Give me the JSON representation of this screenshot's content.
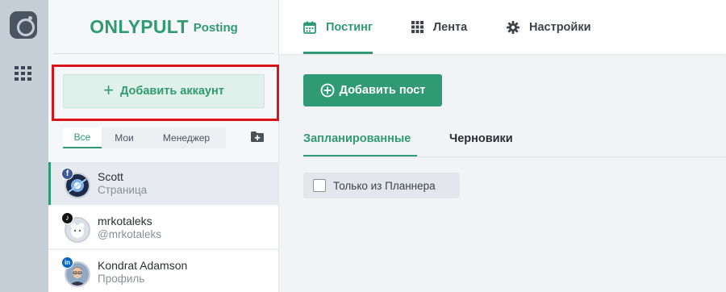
{
  "brand": {
    "name": "ONLYPULT",
    "product": "Posting"
  },
  "rail": {
    "logo_icon": "camera-logo-icon",
    "apps_icon": "grid-icon"
  },
  "sidebar": {
    "add_account_label": "Добавить аккаунт",
    "filters": [
      "Все",
      "Мои",
      "Менеджер"
    ],
    "active_filter": "Все",
    "folder_icon": "folder-plus-icon",
    "accounts": [
      {
        "name": "Scott",
        "subtitle": "Страница",
        "network": "facebook",
        "badge": "f",
        "badge_color": "#3b5998",
        "selected": true
      },
      {
        "name": "mrkotaleks",
        "subtitle": "@mrkotaleks",
        "network": "tiktok",
        "badge": "♪",
        "badge_color": "#111111",
        "selected": false
      },
      {
        "name": "Kondrat Adamson",
        "subtitle": "Профиль",
        "network": "linkedin",
        "badge": "in",
        "badge_color": "#0a66c2",
        "selected": false
      }
    ]
  },
  "main": {
    "tabs": [
      {
        "label": "Постинг",
        "icon": "calendar-icon",
        "active": true
      },
      {
        "label": "Лента",
        "icon": "grid-icon",
        "active": false
      },
      {
        "label": "Настройки",
        "icon": "gear-icon",
        "active": false
      }
    ],
    "add_post_label": "Добавить пост",
    "subtabs": [
      {
        "label": "Запланированные",
        "active": true
      },
      {
        "label": "Черновики",
        "active": false
      }
    ],
    "planner_filter_label": "Только из Планнера",
    "planner_filter_checked": false
  },
  "colors": {
    "accent": "#2f9a73",
    "highlight_border": "#d7141a",
    "rail": "#c5cdd6"
  }
}
